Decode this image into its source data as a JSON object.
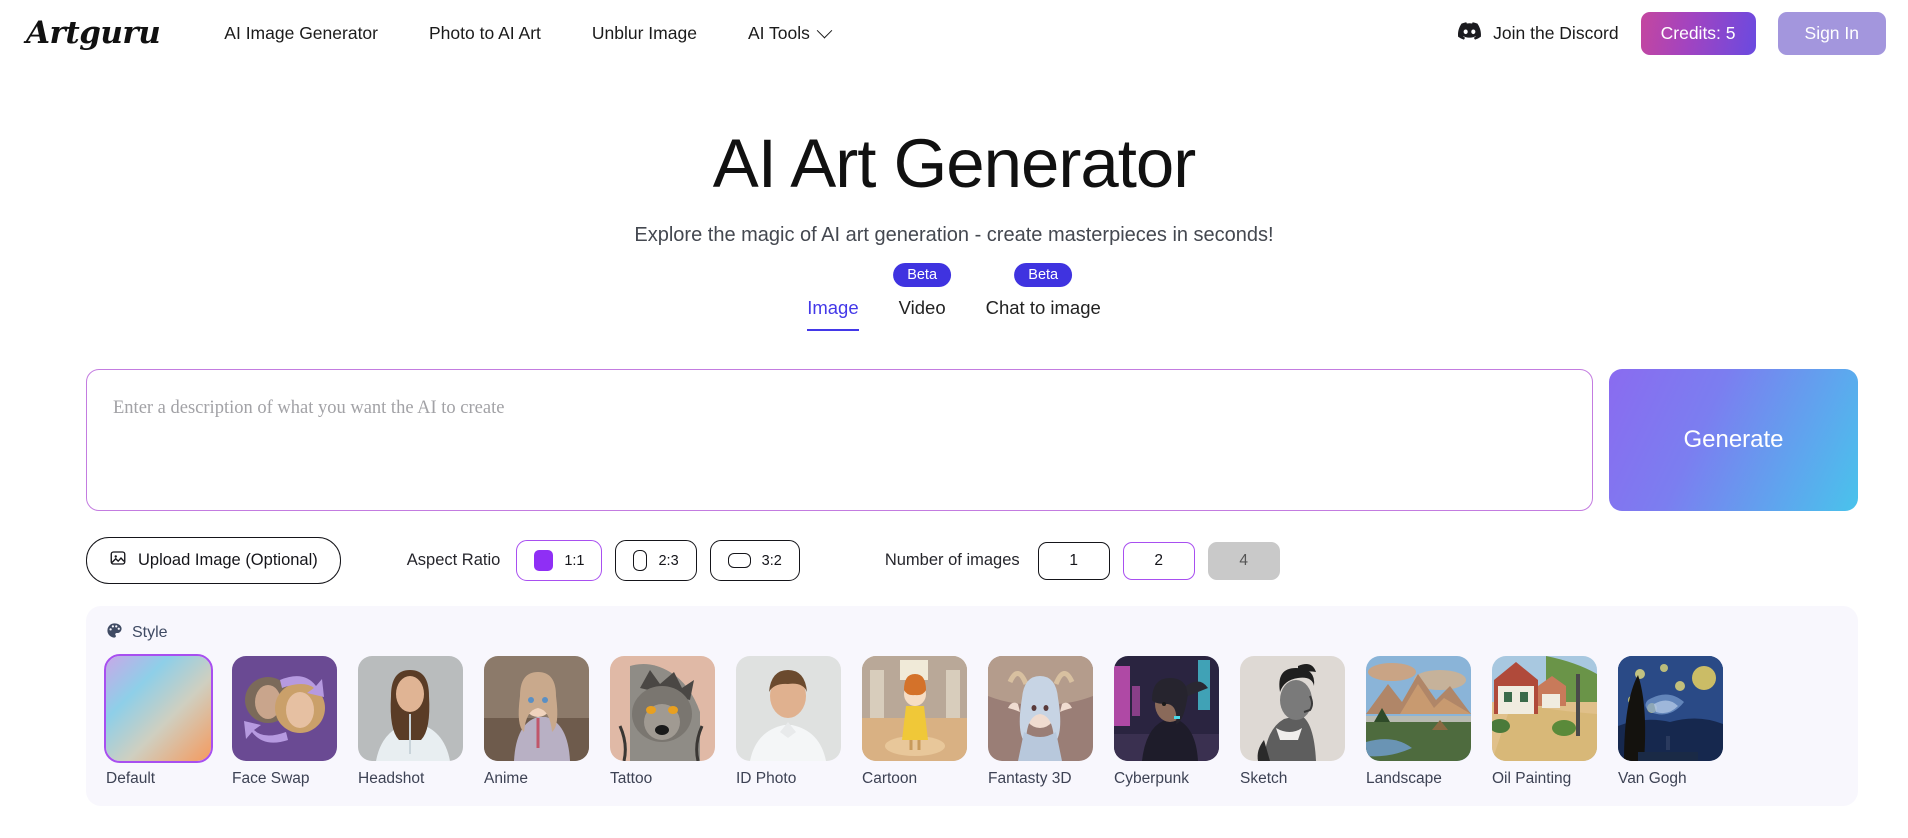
{
  "header": {
    "logo": "Artguru",
    "nav": [
      {
        "label": "AI Image Generator",
        "has_caret": false
      },
      {
        "label": "Photo to AI Art",
        "has_caret": false
      },
      {
        "label": "Unblur Image",
        "has_caret": false
      },
      {
        "label": "AI Tools",
        "has_caret": true
      }
    ],
    "discord_label": "Join the Discord",
    "credits_label": "Credits: 5",
    "signin_label": "Sign In",
    "credits_gradient_from": "#c4469f",
    "credits_gradient_to": "#6a4ae0",
    "signin_color": "#a396dd"
  },
  "hero": {
    "title": "AI Art Generator",
    "subtitle": "Explore the magic of AI art generation - create masterpieces in seconds!"
  },
  "tabs": {
    "active_color": "#4338e8",
    "beta_color": "#3f33e0",
    "items": [
      {
        "label": "Image",
        "beta": "",
        "active": true
      },
      {
        "label": "Video",
        "beta": "Beta",
        "active": false
      },
      {
        "label": "Chat to image",
        "beta": "Beta",
        "active": false
      }
    ]
  },
  "prompt": {
    "placeholder": "Enter a description of what you want the AI to create",
    "value": "",
    "border_color": "#c37ce0",
    "generate_label": "Generate",
    "generate_gradient_from": "#8a6bf0",
    "generate_gradient_to": "#49c3ec"
  },
  "controls": {
    "upload_label": "Upload Image (Optional)",
    "aspect_ratio_label": "Aspect Ratio",
    "aspect_ratios": [
      {
        "label": "1:1",
        "selected": true
      },
      {
        "label": "2:3",
        "selected": false
      },
      {
        "label": "3:2",
        "selected": false
      }
    ],
    "number_label": "Number of images",
    "numbers": [
      {
        "label": "1",
        "selected": false,
        "disabled": false
      },
      {
        "label": "2",
        "selected": true,
        "disabled": false
      },
      {
        "label": "4",
        "selected": false,
        "disabled": true
      }
    ],
    "selected_color": "#a84ff0"
  },
  "style": {
    "section_label": "Style",
    "panel_bg": "#f8f7fd",
    "items": [
      {
        "name": "Default",
        "selected": true
      },
      {
        "name": "Face Swap",
        "selected": false
      },
      {
        "name": "Headshot",
        "selected": false
      },
      {
        "name": "Anime",
        "selected": false
      },
      {
        "name": "Tattoo",
        "selected": false
      },
      {
        "name": "ID Photo",
        "selected": false
      },
      {
        "name": "Cartoon",
        "selected": false
      },
      {
        "name": "Fantasty 3D",
        "selected": false
      },
      {
        "name": "Cyberpunk",
        "selected": false
      },
      {
        "name": "Sketch",
        "selected": false
      },
      {
        "name": "Landscape",
        "selected": false
      },
      {
        "name": "Oil Painting",
        "selected": false
      },
      {
        "name": "Van Gogh",
        "selected": false
      }
    ]
  }
}
